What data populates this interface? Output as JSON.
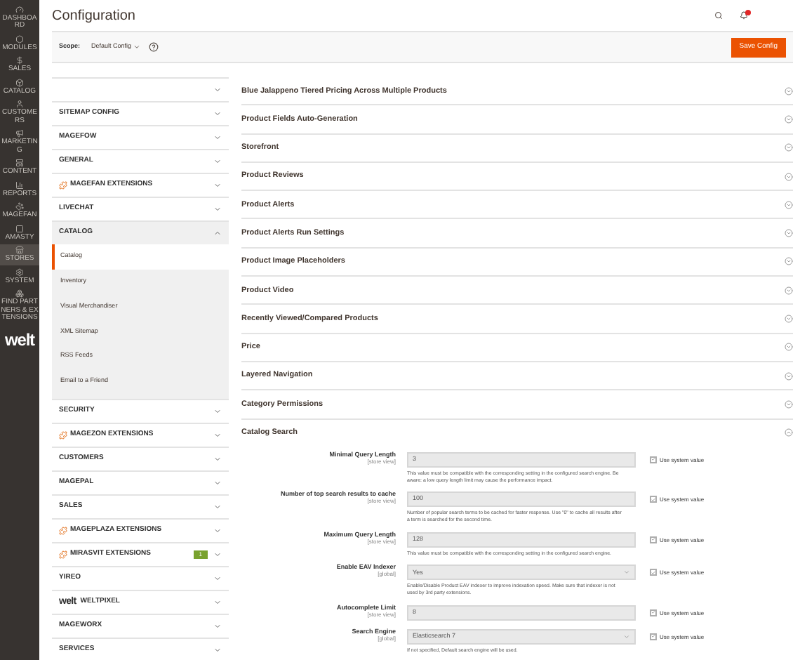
{
  "nav": [
    {
      "label": "DASHBOARD",
      "selected": false
    },
    {
      "label": "MODULES",
      "selected": false
    },
    {
      "label": "SALES",
      "selected": false
    },
    {
      "label": "CATALOG",
      "selected": false
    },
    {
      "label": "CUSTOMERS",
      "selected": false
    },
    {
      "label": "MARKETING",
      "selected": false
    },
    {
      "label": "CONTENT",
      "selected": false
    },
    {
      "label": "REPORTS",
      "selected": false
    },
    {
      "label": "MAGEFAN",
      "selected": false
    },
    {
      "label": "AMASTY",
      "selected": false
    },
    {
      "label": "STORES",
      "selected": true
    },
    {
      "label": "SYSTEM",
      "selected": false
    },
    {
      "label": "FIND PARTNERS & EXTENSIONS",
      "selected": false
    }
  ],
  "logo": "welt",
  "title": "Configuration",
  "scope": {
    "label": "Scope:",
    "value": "Default Config"
  },
  "save_button": "Save Config",
  "tabs": [
    {
      "kind": "plain",
      "expanded": false
    },
    {
      "label": "SITEMAP CONFIG",
      "kind": "plain",
      "expanded": false
    },
    {
      "label": "MAGEFOW",
      "kind": "plain",
      "expanded": false
    },
    {
      "label": "GENERAL",
      "kind": "plain",
      "expanded": false
    },
    {
      "label": "MAGEFAN EXTENSIONS",
      "kind": "vendor",
      "expanded": false
    },
    {
      "label": "LIVECHAT",
      "kind": "plain",
      "expanded": false
    },
    {
      "label": "CATALOG",
      "kind": "plain",
      "expanded": true,
      "children": [
        {
          "label": "Catalog",
          "selected": true
        },
        {
          "label": "Inventory",
          "selected": false
        },
        {
          "label": "Visual Merchandiser",
          "selected": false
        },
        {
          "label": "XML Sitemap",
          "selected": false
        },
        {
          "label": "RSS Feeds",
          "selected": false
        },
        {
          "label": "Email to a Friend",
          "selected": false
        }
      ]
    },
    {
      "label": "SECURITY",
      "kind": "plain",
      "expanded": false
    },
    {
      "label": "MAGEZON EXTENSIONS",
      "kind": "vendor",
      "expanded": false
    },
    {
      "label": "CUSTOMERS",
      "kind": "plain",
      "expanded": false
    },
    {
      "label": "MAGEPAL",
      "kind": "plain",
      "expanded": false
    },
    {
      "label": "SALES",
      "kind": "plain",
      "expanded": false
    },
    {
      "label": "MAGEPLAZA EXTENSIONS",
      "kind": "vendor",
      "expanded": false
    },
    {
      "label": "MIRASVIT EXTENSIONS",
      "kind": "vendor",
      "expanded": false,
      "badge": "1"
    },
    {
      "label": "YIREO",
      "kind": "plain",
      "expanded": false
    },
    {
      "label": "WELTPIXEL",
      "kind": "welt",
      "expanded": false,
      "logo": "welt"
    },
    {
      "label": "MAGEWORX",
      "kind": "plain",
      "expanded": false
    },
    {
      "label": "SERVICES",
      "kind": "plain",
      "expanded": false
    }
  ],
  "sections": [
    {
      "title": "Blue Jalappeno Tiered Pricing Across Multiple Products",
      "expanded": false
    },
    {
      "title": "Product Fields Auto-Generation",
      "expanded": false
    },
    {
      "title": "Storefront",
      "expanded": false
    },
    {
      "title": "Product Reviews",
      "expanded": false
    },
    {
      "title": "Product Alerts",
      "expanded": false
    },
    {
      "title": "Product Alerts Run Settings",
      "expanded": false
    },
    {
      "title": "Product Image Placeholders",
      "expanded": false
    },
    {
      "title": "Product Video",
      "expanded": false
    },
    {
      "title": "Recently Viewed/Compared Products",
      "expanded": false
    },
    {
      "title": "Price",
      "expanded": false
    },
    {
      "title": "Layered Navigation",
      "expanded": false
    },
    {
      "title": "Category Permissions",
      "expanded": false
    },
    {
      "title": "Catalog Search",
      "expanded": true,
      "fields": [
        {
          "label": "Minimal Query Length",
          "scope": "[store view]",
          "kind": "input",
          "value": "3",
          "comment": "This value must be compatible with the corresponding setting in the configured search engine. Be aware: a low query length limit may cause the performance impact.",
          "use_system": "Use system value",
          "checked": true
        },
        {
          "label": "Number of top search results to cache",
          "scope": "[store view]",
          "kind": "input",
          "value": "100",
          "comment": "Number of popular search terms to be cached for faster response. Use \"0\" to cache all results after a term is searched for the second time.",
          "use_system": "Use system value",
          "checked": true
        },
        {
          "label": "Maximum Query Length",
          "scope": "[store view]",
          "kind": "input",
          "value": "128",
          "comment": "This value must be compatible with the corresponding setting in the configured search engine.",
          "use_system": "Use system value",
          "checked": true
        },
        {
          "label": "Enable EAV Indexer",
          "scope": "[global]",
          "kind": "select",
          "value": "Yes",
          "comment": "Enable/Disable Product EAV indexer to improve indexation speed. Make sure that indexer is not used by 3rd party extensions.",
          "use_system": "Use system value",
          "checked": true
        },
        {
          "label": "Autocomplete Limit",
          "scope": "[store view]",
          "kind": "input",
          "value": "8",
          "use_system": "Use system value",
          "checked": true
        },
        {
          "label": "Search Engine",
          "scope": "[global]",
          "kind": "select",
          "value": "Elasticsearch 7",
          "comment": "If not specified, Default search engine will be used.",
          "use_system": "Use system value",
          "checked": true
        }
      ]
    }
  ]
}
